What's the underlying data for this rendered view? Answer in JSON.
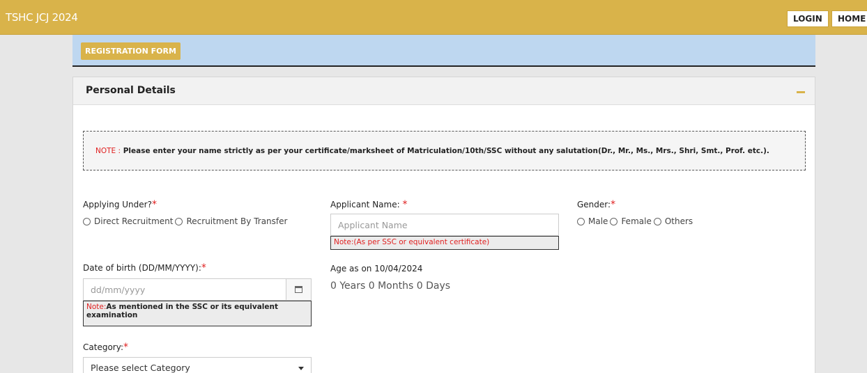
{
  "header": {
    "brand": "TSHC JCJ 2024",
    "login_label": "LOGIN",
    "home_label": "HOME"
  },
  "form_bar": {
    "badge": "REGISTRATION FORM"
  },
  "panel": {
    "title": "Personal Details",
    "note_prefix": "NOTE :",
    "note_text": " Please enter your name strictly as per your certificate/marksheet of Matriculation/10th/SSC without any salutation(Dr., Mr., Ms., Mrs., Shri, Smt., Prof. etc.)."
  },
  "fields": {
    "applying_under": {
      "label": "Applying Under?",
      "required": "*",
      "options": [
        "Direct Recruitment",
        "Recruitment By Transfer"
      ]
    },
    "applicant_name": {
      "label": "Applicant Name: ",
      "required": "*",
      "placeholder": "Applicant Name",
      "hint": "Note:(As per SSC or equivalent certificate)"
    },
    "gender": {
      "label": "Gender:",
      "required": "*",
      "options": [
        "Male",
        "Female",
        "Others"
      ]
    },
    "dob": {
      "label": "Date of birth (DD/MM/YYYY):",
      "required": "*",
      "placeholder": "dd/mm/yyyy",
      "hint_prefix": "Note:",
      "hint_text": "As mentioned in the SSC or its equivalent examination"
    },
    "age": {
      "label": "Age as on 10/04/2024",
      "value": "0 Years 0 Months 0 Days"
    },
    "category": {
      "label": "Category:",
      "required": "*",
      "selected": "Please select Category"
    }
  },
  "colors": {
    "header_bg": "#d9b34a",
    "form_bar_bg": "#bed7f0",
    "required": "#e02020"
  },
  "icons": [
    "calendar-icon",
    "chevron-down-icon",
    "collapse-icon"
  ]
}
